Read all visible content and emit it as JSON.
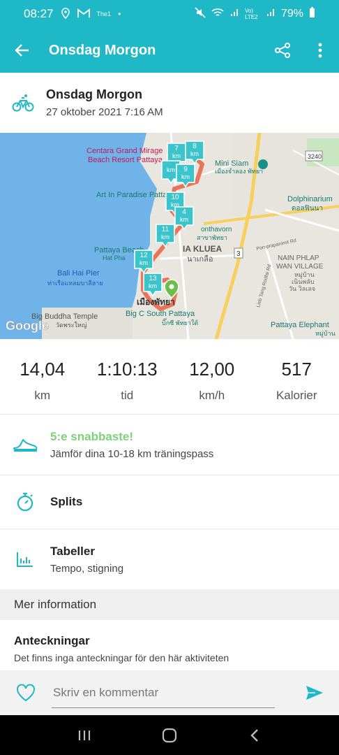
{
  "status_bar": {
    "time": "08:27",
    "indicators": [
      "location-icon",
      "gmail-icon",
      "the1-icon",
      "dot-icon"
    ],
    "the1_label": "The1",
    "network": "Vo) LTE2",
    "battery": "79%"
  },
  "app_bar": {
    "title": "Onsdag Morgon",
    "icons": [
      "back-arrow-icon",
      "share-icon",
      "more-vert-icon"
    ]
  },
  "activity": {
    "icon": "bicycle-icon",
    "title": "Onsdag Morgon",
    "date": "27 oktober 2021 7:16 AM"
  },
  "map": {
    "labels": {
      "centara": "Centara Grand Mirage",
      "centara2": "Beach Resort Pattaya",
      "art": "Art In Paradise Pattaya",
      "mini_siam": "Mini Siam",
      "mini_siam_th": "เมืองจำลอง พัทยา",
      "dolphinarium": "Dolphinarium",
      "dolphinarium_th": "ดอลฟินนา",
      "pattaya_beach": "Pattaya Beach",
      "hat_pha": "Hat Pha",
      "bali_hai": "Bali Hai Pier",
      "bali_hai_th": "ท่าเรือแหลมบาลีฮาย",
      "nain_phlap": "NAIN PHLAP",
      "wan_village": "WAN VILLAGE",
      "nain_th1": "หมู่บ้าน",
      "nain_th2": "เนินพลับ",
      "nain_th3": "วัน วิลเลจ",
      "buddha": "Big Buddha Temple",
      "buddha_th": "วัดพระใหญ่",
      "big_c": "Big C South Pattaya",
      "big_c_th": "บิ๊กซี พัทยาใต้",
      "pattaya_elephant": "Pattaya Elephant",
      "elephant_th": "หมู่บ้าน",
      "klua": "IA KLUEA",
      "klua_th": "นาเกลือ",
      "road_3240": "3240",
      "road_3": "3",
      "pornprapanimit": "Pornprapanimit Rd",
      "lieb": "Lieb Tang Rodfai Rd",
      "onthavorn": "onthavorn",
      "branch": "สาขาพัทยา",
      "pattaya_th": "เมืองพัทยา",
      "google": "Google"
    },
    "markers": [
      "7 km",
      "8 km",
      "9 km",
      "10 km",
      "4 km",
      "11 km",
      "12 km",
      "13 km",
      "km"
    ]
  },
  "stats": [
    {
      "value": "14,04",
      "label": "km"
    },
    {
      "value": "1:10:13",
      "label": "tid"
    },
    {
      "value": "12,00",
      "label": "km/h"
    },
    {
      "value": "517",
      "label": "Kalorier"
    }
  ],
  "achievement": {
    "icon": "sneaker-icon",
    "title": "5:e snabbaste!",
    "subtitle": "Jämför dina 10-18 km träningspass"
  },
  "splits": {
    "icon": "stopwatch-icon",
    "title": "Splits"
  },
  "tables": {
    "icon": "bar-chart-icon",
    "title": "Tabeller",
    "subtitle": "Tempo, stigning"
  },
  "more_info": {
    "header": "Mer information"
  },
  "notes": {
    "title": "Anteckningar",
    "subtitle": "Det finns inga anteckningar för den här aktiviteten"
  },
  "comment": {
    "placeholder": "Skriv en kommentar"
  },
  "colors": {
    "accent": "#1fb8c6",
    "route": "#e8745a",
    "marker": "#3cc4cc",
    "achievement": "#7fd07a"
  }
}
